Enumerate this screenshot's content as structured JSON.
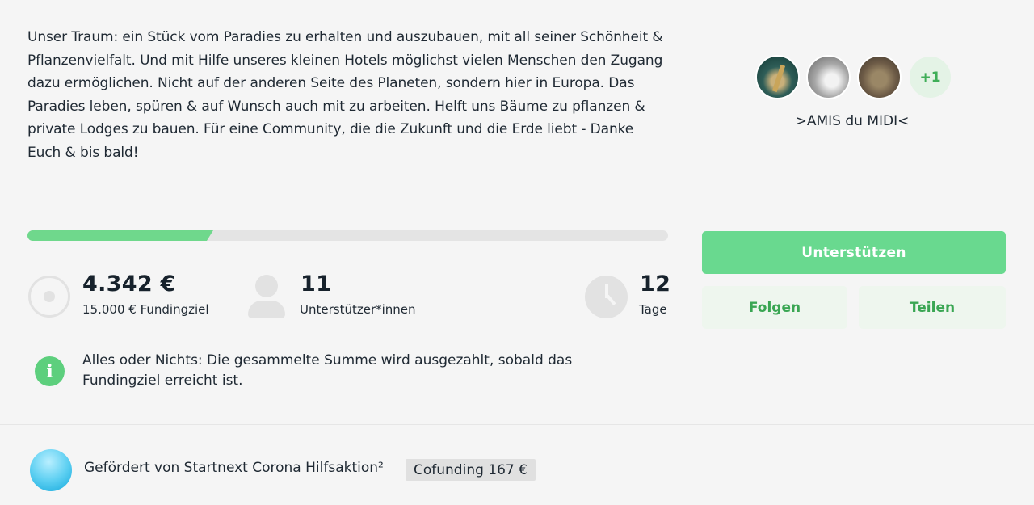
{
  "project": {
    "description": "Unser Traum: ein Stück vom Paradies zu erhalten und auszubauen, mit all seiner Schönheit & Pflanzenvielfalt. Und mit Hilfe unseres kleinen Hotels möglichst vielen Menschen den Zugang dazu ermöglichen. Nicht auf der anderen Seite des Planeten, sondern hier in Europa. Das Paradies leben, spüren & auf Wunsch auch mit zu arbeiten. Helft uns Bäume zu pflanzen & private Lodges zu bauen. Für eine Community, die die Zukunft und die Erde liebt - Danke Euch & bis bald!"
  },
  "team": {
    "more_count": "+1",
    "name": ">AMIS du MIDI<"
  },
  "progress": {
    "fraction": 0.29,
    "color": "#6fd88c"
  },
  "stats": {
    "funding": {
      "value": "4.342 €",
      "label": "15.000 € Fundingziel",
      "icon": "target-icon"
    },
    "supporters": {
      "value": "11",
      "label": "Unterstützer*innen",
      "icon": "person-icon"
    },
    "days": {
      "value": "12",
      "label": "Tage",
      "icon": "clock-icon"
    }
  },
  "info": {
    "icon": "info-icon",
    "text": "Alles oder Nichts: Die gesammelte Summe wird ausgezahlt, sobald das Fundingziel erreicht ist."
  },
  "actions": {
    "support_label": "Unterstützen",
    "follow_label": "Folgen",
    "share_label": "Teilen"
  },
  "sponsor": {
    "text": "Gefördert von Startnext Corona Hilfsaktion²",
    "badge": "Cofunding 167 €"
  },
  "colors": {
    "accent": "#69d98f",
    "accent_text": "#3aa653",
    "secondary_button_bg": "#eef6ee"
  }
}
